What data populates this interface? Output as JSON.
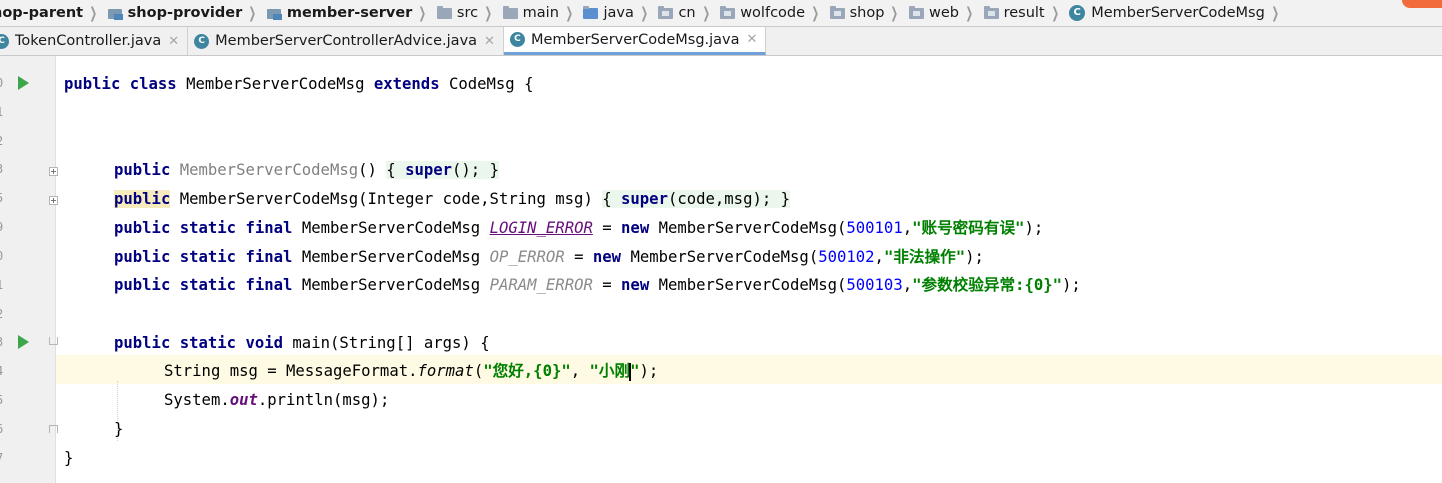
{
  "breadcrumb": {
    "items": [
      {
        "label": "hop-parent",
        "icon": "module-icon",
        "bold": true
      },
      {
        "label": "shop-provider",
        "icon": "module-icon",
        "bold": true
      },
      {
        "label": "member-server",
        "icon": "module-icon",
        "bold": true
      },
      {
        "label": "src",
        "icon": "folder-icon"
      },
      {
        "label": "main",
        "icon": "folder-icon"
      },
      {
        "label": "java",
        "icon": "source-folder-icon"
      },
      {
        "label": "cn",
        "icon": "package-icon"
      },
      {
        "label": "wolfcode",
        "icon": "package-icon"
      },
      {
        "label": "shop",
        "icon": "package-icon"
      },
      {
        "label": "web",
        "icon": "package-icon"
      },
      {
        "label": "result",
        "icon": "package-icon"
      },
      {
        "label": "MemberServerCodeMsg",
        "icon": "class-icon"
      }
    ]
  },
  "tabs": [
    {
      "label": "TokenController.java",
      "active": false
    },
    {
      "label": "MemberServerControllerAdvice.java",
      "active": false
    },
    {
      "label": "MemberServerCodeMsg.java",
      "active": true
    }
  ],
  "gutter": {
    "line_numbers": [
      "0",
      "1",
      "2",
      "3",
      "5",
      "9",
      "0",
      "1",
      "2",
      "3",
      "4",
      "5",
      "6",
      "7"
    ]
  },
  "code": {
    "class_decl": {
      "kw1": "public",
      "kw2": "class",
      "name": "MemberServerCodeMsg",
      "kw3": "extends",
      "parent": "CodeMsg",
      "open": "{"
    },
    "ctor1": {
      "kw": "public",
      "name": "MemberServerCodeMsg",
      "params": "()",
      "body_open": "{",
      "super": "super",
      "args": "();",
      "body_close": "}"
    },
    "ctor2": {
      "kw": "public",
      "name": "MemberServerCodeMsg",
      "params": "(Integer code,String msg)",
      "body_open": "{",
      "super": "super",
      "args": "(code,msg);",
      "body_close": "}"
    },
    "fields": [
      {
        "mods_public": "public",
        "mods_static": "static",
        "mods_final": "final",
        "type": "MemberServerCodeMsg",
        "name": "LOGIN_ERROR",
        "eq": "=",
        "new": "new",
        "ctor": "MemberServerCodeMsg(",
        "code": "500101",
        "comma": ",",
        "msg": "\"账号密码有误\"",
        "end": ");"
      },
      {
        "mods_public": "public",
        "mods_static": "static",
        "mods_final": "final",
        "type": "MemberServerCodeMsg",
        "name": "OP_ERROR",
        "eq": "=",
        "new": "new",
        "ctor": "MemberServerCodeMsg(",
        "code": "500102",
        "comma": ",",
        "msg": "\"非法操作\"",
        "end": ");"
      },
      {
        "mods_public": "public",
        "mods_static": "static",
        "mods_final": "final",
        "type": "MemberServerCodeMsg",
        "name": "PARAM_ERROR",
        "eq": "=",
        "new": "new",
        "ctor": "MemberServerCodeMsg(",
        "code": "500103",
        "comma": ",",
        "msg": "\"参数校验异常:{0}\"",
        "end": ");"
      }
    ],
    "main_decl": {
      "kw1": "public",
      "kw2": "static",
      "kw3": "void",
      "name": "main(String[] args)",
      "open": "{"
    },
    "stmt1": {
      "pre": "String msg = MessageFormat.",
      "method": "format",
      "open": "(",
      "str1": "\"您好,{0}\"",
      "mid": ", ",
      "str2a": "\"小刚",
      "str2b": "\"",
      "end": ");"
    },
    "stmt2": {
      "pre": "System.",
      "field": "out",
      "post": ".println(msg);"
    },
    "close_method": "}",
    "close_class": "}"
  }
}
